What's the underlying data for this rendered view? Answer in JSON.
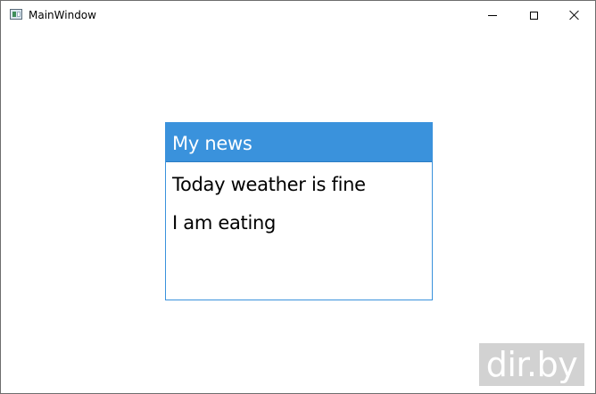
{
  "window": {
    "title": "MainWindow",
    "icon": "app-window-icon",
    "controls": {
      "minimize_icon": "minimize-icon",
      "maximize_icon": "maximize-icon",
      "close_icon": "close-icon"
    }
  },
  "news": {
    "header": "My news",
    "items": [
      "Today weather is fine",
      "I am eating"
    ]
  },
  "watermark": {
    "text": "dir.by"
  },
  "colors": {
    "header_background": "#3a92dc",
    "panel_border": "#3a92dc",
    "watermark_background": "#d2d2d2"
  }
}
